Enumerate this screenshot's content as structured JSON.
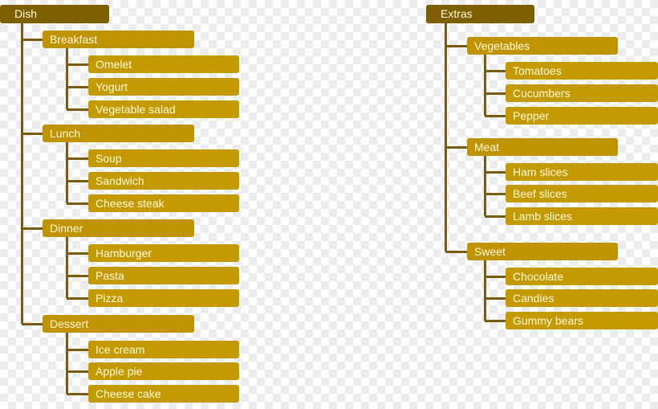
{
  "colors": {
    "root": "#7d5f00",
    "node": "#c09300",
    "connector": "#7a5c10",
    "text": "#fff8e0"
  },
  "trees": [
    {
      "root": "Dish",
      "categories": [
        {
          "label": "Breakfast",
          "items": [
            "Omelet",
            "Yogurt",
            "Vegetable salad"
          ]
        },
        {
          "label": "Lunch",
          "items": [
            "Soup",
            "Sandwich",
            "Cheese steak"
          ]
        },
        {
          "label": "Dinner",
          "items": [
            "Hamburger",
            "Pasta",
            "Pizza"
          ]
        },
        {
          "label": "Dessert",
          "items": [
            "Ice cream",
            "Apple pie",
            "Cheese cake"
          ]
        }
      ]
    },
    {
      "root": "Extras",
      "categories": [
        {
          "label": "Vegetables",
          "items": [
            "Tomatoes",
            "Cucumbers",
            "Pepper"
          ]
        },
        {
          "label": "Meat",
          "items": [
            "Ham slices",
            "Beef slices",
            "Lamb slices"
          ]
        },
        {
          "label": "Sweet",
          "items": [
            "Chocolate",
            "Candies",
            "Gummy bears"
          ]
        }
      ]
    }
  ]
}
